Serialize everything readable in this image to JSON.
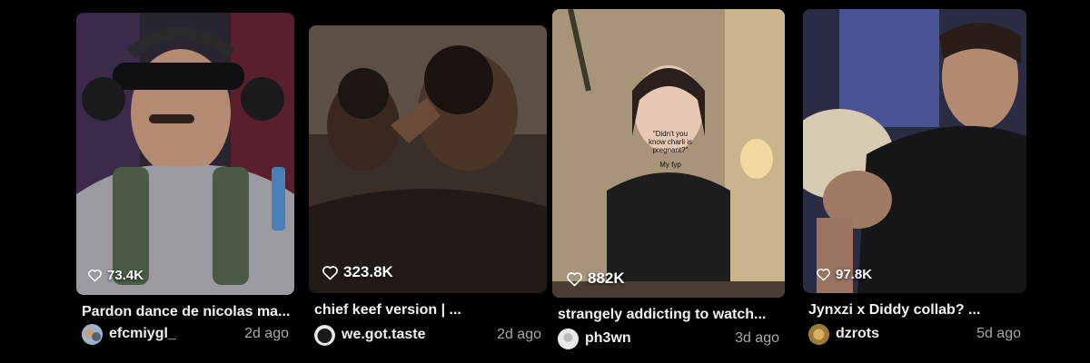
{
  "videos": [
    {
      "likes": "73.4K",
      "title": "Pardon dance de nicolas ma...",
      "username": "efcmiygl_",
      "age": "2d ago",
      "avatar_color": "#8a9bb0"
    },
    {
      "likes": "323.8K",
      "title": "chief keef version | ...",
      "username": "we.got.taste",
      "age": "2d ago",
      "avatar_color": "#222222"
    },
    {
      "likes": "882K",
      "title": "strangely addicting to watch...",
      "username": "ph3wn",
      "age": "3d ago",
      "avatar_color": "#dcdcdc",
      "overlay_caption": "\"Didn't you know charli is pregnant?\"",
      "overlay_sub": "My fyp"
    },
    {
      "likes": "97.8K",
      "title": "Jynxzi x Diddy collab? ...",
      "username": "dzrots",
      "age": "5d ago",
      "avatar_color": "#b08a3c"
    }
  ],
  "icons": {
    "like": "heart-outline-icon"
  }
}
